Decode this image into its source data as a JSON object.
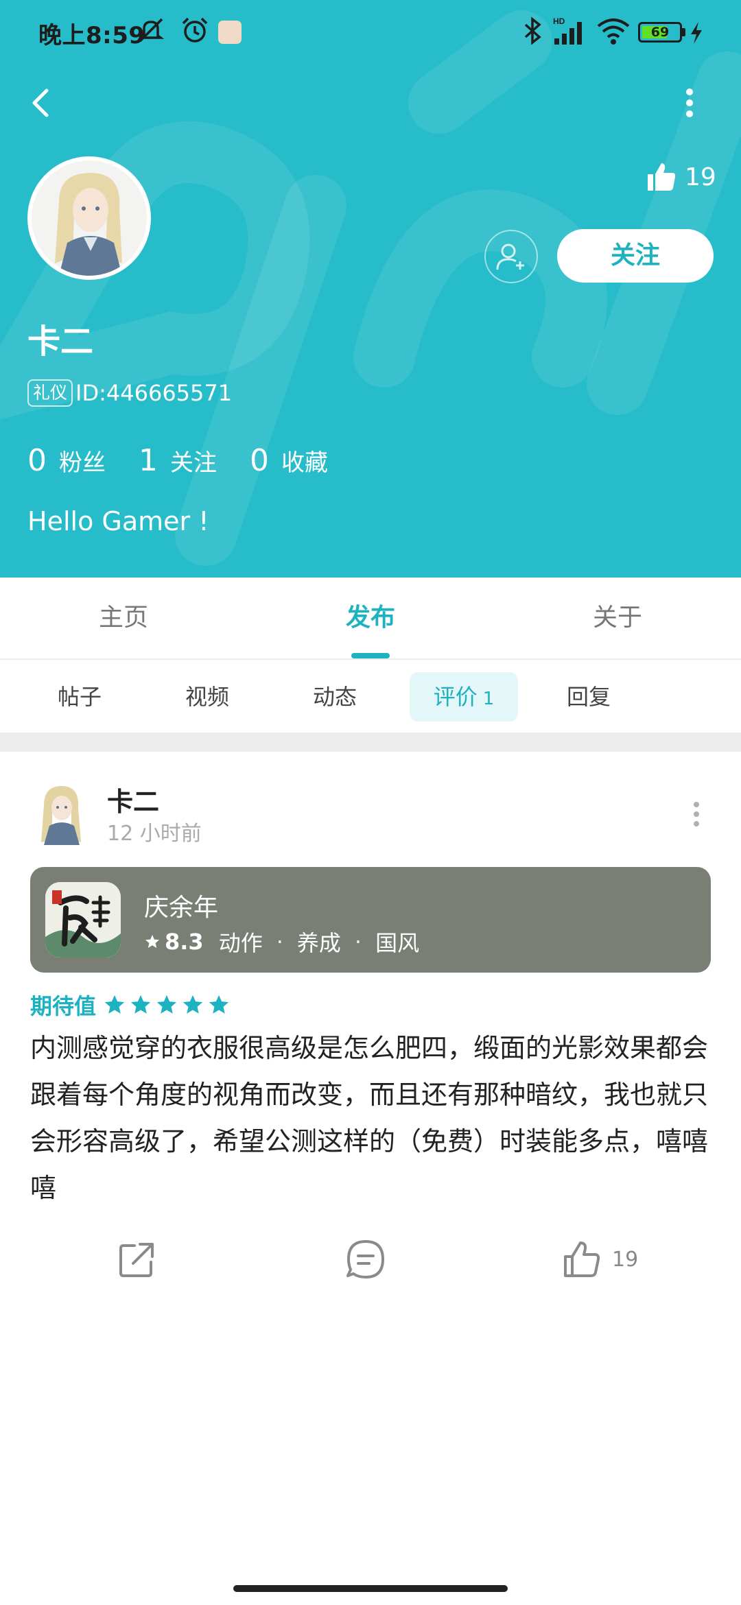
{
  "status_bar": {
    "time": "晚上8:59",
    "battery": "69",
    "battery_level": 0.69,
    "network": "HD"
  },
  "profile": {
    "name": "卡二",
    "id_badge": "礼仪",
    "id_text": "ID:446665571",
    "likes": "19",
    "follow_label": "关注",
    "stats": [
      {
        "num": "0",
        "label": "粉丝"
      },
      {
        "num": "1",
        "label": "关注"
      },
      {
        "num": "0",
        "label": "收藏"
      }
    ],
    "bio": "Hello Gamer !"
  },
  "main_tabs": [
    "主页",
    "发布",
    "关于"
  ],
  "sub_tabs": [
    "帖子",
    "视频",
    "动态",
    "评价",
    "回复"
  ],
  "sub_tab_active_count": "1",
  "post": {
    "author": "卡二",
    "time": "12 小时前",
    "game": {
      "title": "庆余年",
      "score": "8.3",
      "tags": [
        "动作",
        "养成",
        "国风"
      ]
    },
    "rating_label": "期待值",
    "rating_stars": 5,
    "body": "内测感觉穿的衣服很高级是怎么肥四，缎面的光影效果都会跟着每个角度的视角而改变，而且还有那种暗纹，我也就只会形容高级了，希望公测这样的（免费）时装能多点，嘻嘻嘻",
    "like_count": "19"
  },
  "colors": {
    "accent": "#1db2c0",
    "header_bg": "#26bcc9",
    "card_bg": "#7a7f76"
  },
  "icons": [
    "back-icon",
    "more-vertical-icon",
    "thumbs-up-icon",
    "add-friend-icon",
    "share-icon",
    "comment-icon",
    "star-icon",
    "bluetooth-icon",
    "signal-icon",
    "wifi-icon",
    "alarm-icon",
    "mute-icon",
    "charging-icon"
  ]
}
